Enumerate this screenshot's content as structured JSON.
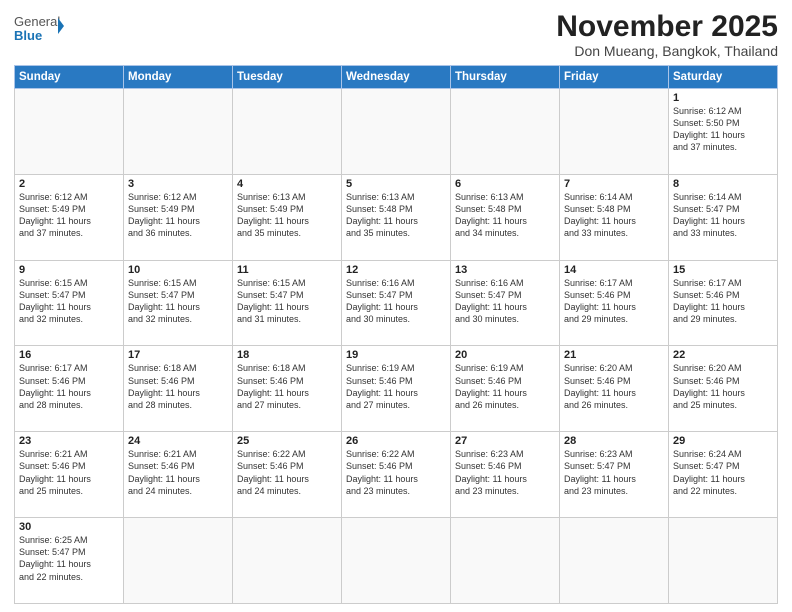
{
  "logo": {
    "text_general": "General",
    "text_blue": "Blue"
  },
  "header": {
    "month_title": "November 2025",
    "location": "Don Mueang, Bangkok, Thailand"
  },
  "weekdays": [
    "Sunday",
    "Monday",
    "Tuesday",
    "Wednesday",
    "Thursday",
    "Friday",
    "Saturday"
  ],
  "weeks": [
    [
      {
        "day": "",
        "info": ""
      },
      {
        "day": "",
        "info": ""
      },
      {
        "day": "",
        "info": ""
      },
      {
        "day": "",
        "info": ""
      },
      {
        "day": "",
        "info": ""
      },
      {
        "day": "",
        "info": ""
      },
      {
        "day": "1",
        "info": "Sunrise: 6:12 AM\nSunset: 5:50 PM\nDaylight: 11 hours\nand 37 minutes."
      }
    ],
    [
      {
        "day": "2",
        "info": "Sunrise: 6:12 AM\nSunset: 5:49 PM\nDaylight: 11 hours\nand 37 minutes."
      },
      {
        "day": "3",
        "info": "Sunrise: 6:12 AM\nSunset: 5:49 PM\nDaylight: 11 hours\nand 36 minutes."
      },
      {
        "day": "4",
        "info": "Sunrise: 6:13 AM\nSunset: 5:49 PM\nDaylight: 11 hours\nand 35 minutes."
      },
      {
        "day": "5",
        "info": "Sunrise: 6:13 AM\nSunset: 5:48 PM\nDaylight: 11 hours\nand 35 minutes."
      },
      {
        "day": "6",
        "info": "Sunrise: 6:13 AM\nSunset: 5:48 PM\nDaylight: 11 hours\nand 34 minutes."
      },
      {
        "day": "7",
        "info": "Sunrise: 6:14 AM\nSunset: 5:48 PM\nDaylight: 11 hours\nand 33 minutes."
      },
      {
        "day": "8",
        "info": "Sunrise: 6:14 AM\nSunset: 5:47 PM\nDaylight: 11 hours\nand 33 minutes."
      }
    ],
    [
      {
        "day": "9",
        "info": "Sunrise: 6:15 AM\nSunset: 5:47 PM\nDaylight: 11 hours\nand 32 minutes."
      },
      {
        "day": "10",
        "info": "Sunrise: 6:15 AM\nSunset: 5:47 PM\nDaylight: 11 hours\nand 32 minutes."
      },
      {
        "day": "11",
        "info": "Sunrise: 6:15 AM\nSunset: 5:47 PM\nDaylight: 11 hours\nand 31 minutes."
      },
      {
        "day": "12",
        "info": "Sunrise: 6:16 AM\nSunset: 5:47 PM\nDaylight: 11 hours\nand 30 minutes."
      },
      {
        "day": "13",
        "info": "Sunrise: 6:16 AM\nSunset: 5:47 PM\nDaylight: 11 hours\nand 30 minutes."
      },
      {
        "day": "14",
        "info": "Sunrise: 6:17 AM\nSunset: 5:46 PM\nDaylight: 11 hours\nand 29 minutes."
      },
      {
        "day": "15",
        "info": "Sunrise: 6:17 AM\nSunset: 5:46 PM\nDaylight: 11 hours\nand 29 minutes."
      }
    ],
    [
      {
        "day": "16",
        "info": "Sunrise: 6:17 AM\nSunset: 5:46 PM\nDaylight: 11 hours\nand 28 minutes."
      },
      {
        "day": "17",
        "info": "Sunrise: 6:18 AM\nSunset: 5:46 PM\nDaylight: 11 hours\nand 28 minutes."
      },
      {
        "day": "18",
        "info": "Sunrise: 6:18 AM\nSunset: 5:46 PM\nDaylight: 11 hours\nand 27 minutes."
      },
      {
        "day": "19",
        "info": "Sunrise: 6:19 AM\nSunset: 5:46 PM\nDaylight: 11 hours\nand 27 minutes."
      },
      {
        "day": "20",
        "info": "Sunrise: 6:19 AM\nSunset: 5:46 PM\nDaylight: 11 hours\nand 26 minutes."
      },
      {
        "day": "21",
        "info": "Sunrise: 6:20 AM\nSunset: 5:46 PM\nDaylight: 11 hours\nand 26 minutes."
      },
      {
        "day": "22",
        "info": "Sunrise: 6:20 AM\nSunset: 5:46 PM\nDaylight: 11 hours\nand 25 minutes."
      }
    ],
    [
      {
        "day": "23",
        "info": "Sunrise: 6:21 AM\nSunset: 5:46 PM\nDaylight: 11 hours\nand 25 minutes."
      },
      {
        "day": "24",
        "info": "Sunrise: 6:21 AM\nSunset: 5:46 PM\nDaylight: 11 hours\nand 24 minutes."
      },
      {
        "day": "25",
        "info": "Sunrise: 6:22 AM\nSunset: 5:46 PM\nDaylight: 11 hours\nand 24 minutes."
      },
      {
        "day": "26",
        "info": "Sunrise: 6:22 AM\nSunset: 5:46 PM\nDaylight: 11 hours\nand 23 minutes."
      },
      {
        "day": "27",
        "info": "Sunrise: 6:23 AM\nSunset: 5:46 PM\nDaylight: 11 hours\nand 23 minutes."
      },
      {
        "day": "28",
        "info": "Sunrise: 6:23 AM\nSunset: 5:47 PM\nDaylight: 11 hours\nand 23 minutes."
      },
      {
        "day": "29",
        "info": "Sunrise: 6:24 AM\nSunset: 5:47 PM\nDaylight: 11 hours\nand 22 minutes."
      }
    ],
    [
      {
        "day": "30",
        "info": "Sunrise: 6:25 AM\nSunset: 5:47 PM\nDaylight: 11 hours\nand 22 minutes."
      },
      {
        "day": "",
        "info": ""
      },
      {
        "day": "",
        "info": ""
      },
      {
        "day": "",
        "info": ""
      },
      {
        "day": "",
        "info": ""
      },
      {
        "day": "",
        "info": ""
      },
      {
        "day": "",
        "info": ""
      }
    ]
  ]
}
